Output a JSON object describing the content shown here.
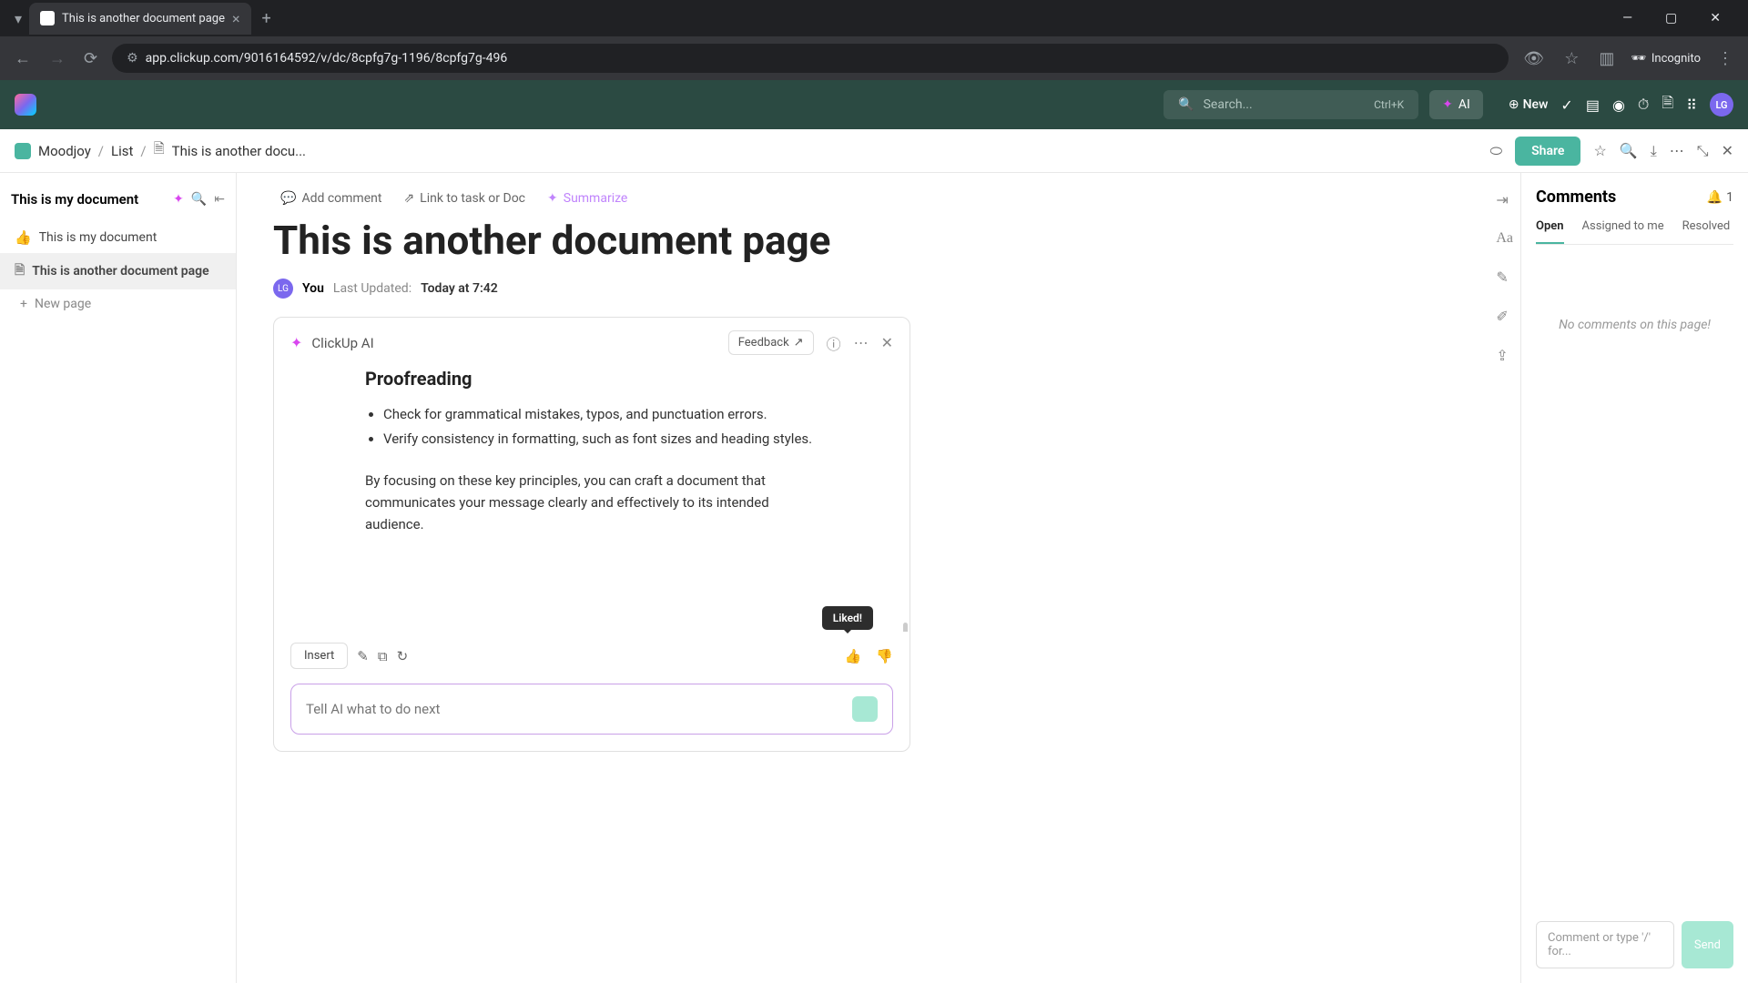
{
  "browser": {
    "tab_title": "This is another document page",
    "url": "app.clickup.com/9016164592/v/dc/8cpfg7g-1196/8cpfg7g-496",
    "incognito_label": "Incognito"
  },
  "header": {
    "search_placeholder": "Search...",
    "search_kbd": "Ctrl+K",
    "ai_label": "AI",
    "new_label": "New",
    "avatar_initials": "LG"
  },
  "breadcrumb": {
    "workspace": "Moodjoy",
    "list": "List",
    "page": "This is another docu...",
    "share_label": "Share"
  },
  "sidebar": {
    "doc_title": "This is my document",
    "items": [
      {
        "emoji": "👍",
        "label": "This is my document"
      },
      {
        "icon": "doc",
        "label": "This is another document page"
      }
    ],
    "new_page_label": "New page"
  },
  "document": {
    "actions": {
      "add_comment": "Add comment",
      "link_task": "Link to task or Doc",
      "summarize": "Summarize"
    },
    "title": "This is another document page",
    "author": "You",
    "avatar_initials": "LG",
    "last_updated_label": "Last Updated:",
    "last_updated_time": "Today at 7:42"
  },
  "ai_panel": {
    "name": "ClickUp AI",
    "feedback_label": "Feedback",
    "heading": "Proofreading",
    "bullets": [
      "Check for grammatical mistakes, typos, and punctuation errors.",
      "Verify consistency in formatting, such as font sizes and heading styles."
    ],
    "paragraph": "By focusing on these key principles, you can craft a document that communicates your message clearly and effectively to its intended audience.",
    "insert_label": "Insert",
    "liked_tooltip": "Liked!",
    "input_placeholder": "Tell AI what to do next"
  },
  "comments": {
    "title": "Comments",
    "notif_count": "1",
    "tabs": {
      "open": "Open",
      "assigned": "Assigned to me",
      "resolved": "Resolved"
    },
    "empty": "No comments on this page!",
    "input_placeholder": "Comment or type '/' for...",
    "send_label": "Send"
  }
}
